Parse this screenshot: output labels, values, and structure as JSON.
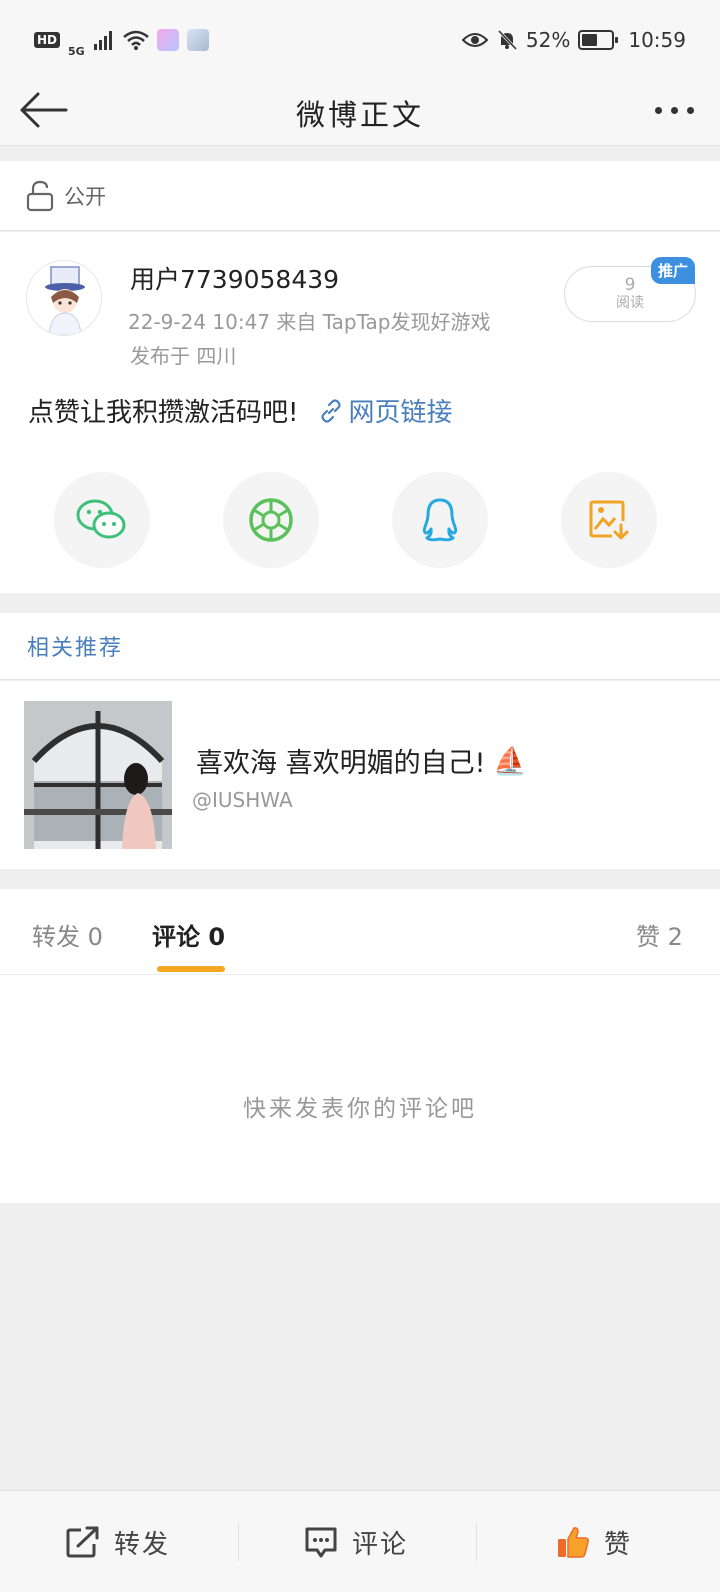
{
  "status_bar": {
    "hd": "HD",
    "signal": "5G",
    "battery_percent": "52%",
    "battery_level": 0.52,
    "time": "10:59"
  },
  "nav": {
    "title": "微博正文"
  },
  "post": {
    "visibility_label": "公开",
    "username": "用户7739058439",
    "time_source": "22-9-24 10:47  来自 TapTap发现好游戏",
    "location": "发布于 四川",
    "read_count": "9",
    "read_label": "阅读",
    "promo_badge": "推广",
    "text": "点赞让我积攒激活码吧!",
    "link_text": "网页链接",
    "share_icons": [
      "wechat-icon",
      "moments-icon",
      "qq-icon",
      "save-image-icon"
    ]
  },
  "related": {
    "header": "相关推荐",
    "items": [
      {
        "title": "喜欢海 喜欢明媚的自己!",
        "author": "@IUSHWA",
        "emoji": "⛵"
      }
    ]
  },
  "tabs": {
    "repost": "转发 0",
    "comment": "评论 0",
    "like": "赞 2",
    "active": "comment",
    "empty_hint": "快来发表你的评论吧"
  },
  "bottom_bar": {
    "repost": "转发",
    "comment": "评论",
    "like": "赞"
  },
  "colors": {
    "accent_orange": "#f5a623",
    "link_blue": "#4a7fbd",
    "promo_blue": "#3d8fe0"
  }
}
